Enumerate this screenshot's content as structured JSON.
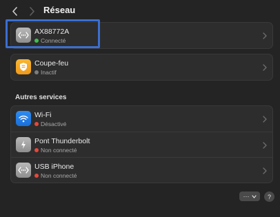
{
  "window": {
    "title": "Réseau"
  },
  "colors": {
    "connected": "#3fc04f",
    "inactive": "#7d7d7d",
    "disabled": "#e5483a",
    "highlight": "#3b6fd0"
  },
  "services": [
    {
      "name": "AX88772A",
      "status": "Connecté",
      "status_color": "connected",
      "icon": "ethernet-icon"
    },
    {
      "name": "Coupe-feu",
      "status": "Inactif",
      "status_color": "inactive",
      "icon": "firewall-icon"
    }
  ],
  "other_section": {
    "label": "Autres services"
  },
  "other_services": [
    {
      "name": "Wi‑Fi",
      "status": "Désactivé",
      "status_color": "disabled",
      "icon": "wifi-icon"
    },
    {
      "name": "Pont Thunderbolt",
      "status": "Non connecté",
      "status_color": "disabled",
      "icon": "thunderbolt-icon"
    },
    {
      "name": "USB iPhone",
      "status": "Non connecté",
      "status_color": "disabled",
      "icon": "usb-iphone-icon"
    }
  ],
  "footer": {
    "more_label": "···",
    "help_label": "?"
  }
}
